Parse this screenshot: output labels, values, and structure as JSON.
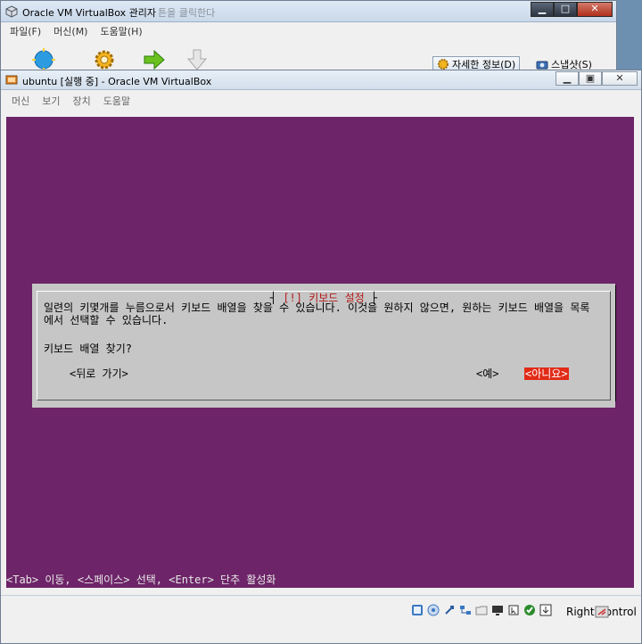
{
  "manager": {
    "title": "Oracle VM VirtualBox 관리자",
    "ghost_text": "튼을 클릭한다",
    "menu": [
      "파일(F)",
      "머신(M)",
      "도움말(H)"
    ],
    "toolbar": {
      "details_label": "자세한 정보(D)",
      "snapshots_label": "스냅샷(S)"
    }
  },
  "vm_window": {
    "title": "ubuntu [실행 중] - Oracle VM VirtualBox",
    "menu": [
      "머신",
      "보기",
      "장치",
      "도움말"
    ]
  },
  "guest": {
    "dialog": {
      "title": "[!] 키보드 설정",
      "message": "일련의 키몇개를 누름으로서 키보드 배열을 찾을 수 있습니다. 이것을 원하지 않으면, 원하는 키보드 배열을 목록에서 선택할 수 있습니다.",
      "question": "키보드 배열 찾기?",
      "back_label": "<뒤로 가기>",
      "yes_label": "<예>",
      "no_label": "<아니요>"
    },
    "hint": "<Tab> 이동, <스페이스> 선택, <Enter> 단추 활성화"
  },
  "status_bar": {
    "host_key": "Right Control"
  },
  "colors": {
    "guest_background": "#6d2468",
    "dialog_background": "#c6c6c6",
    "selected_button": "#e12b17"
  }
}
